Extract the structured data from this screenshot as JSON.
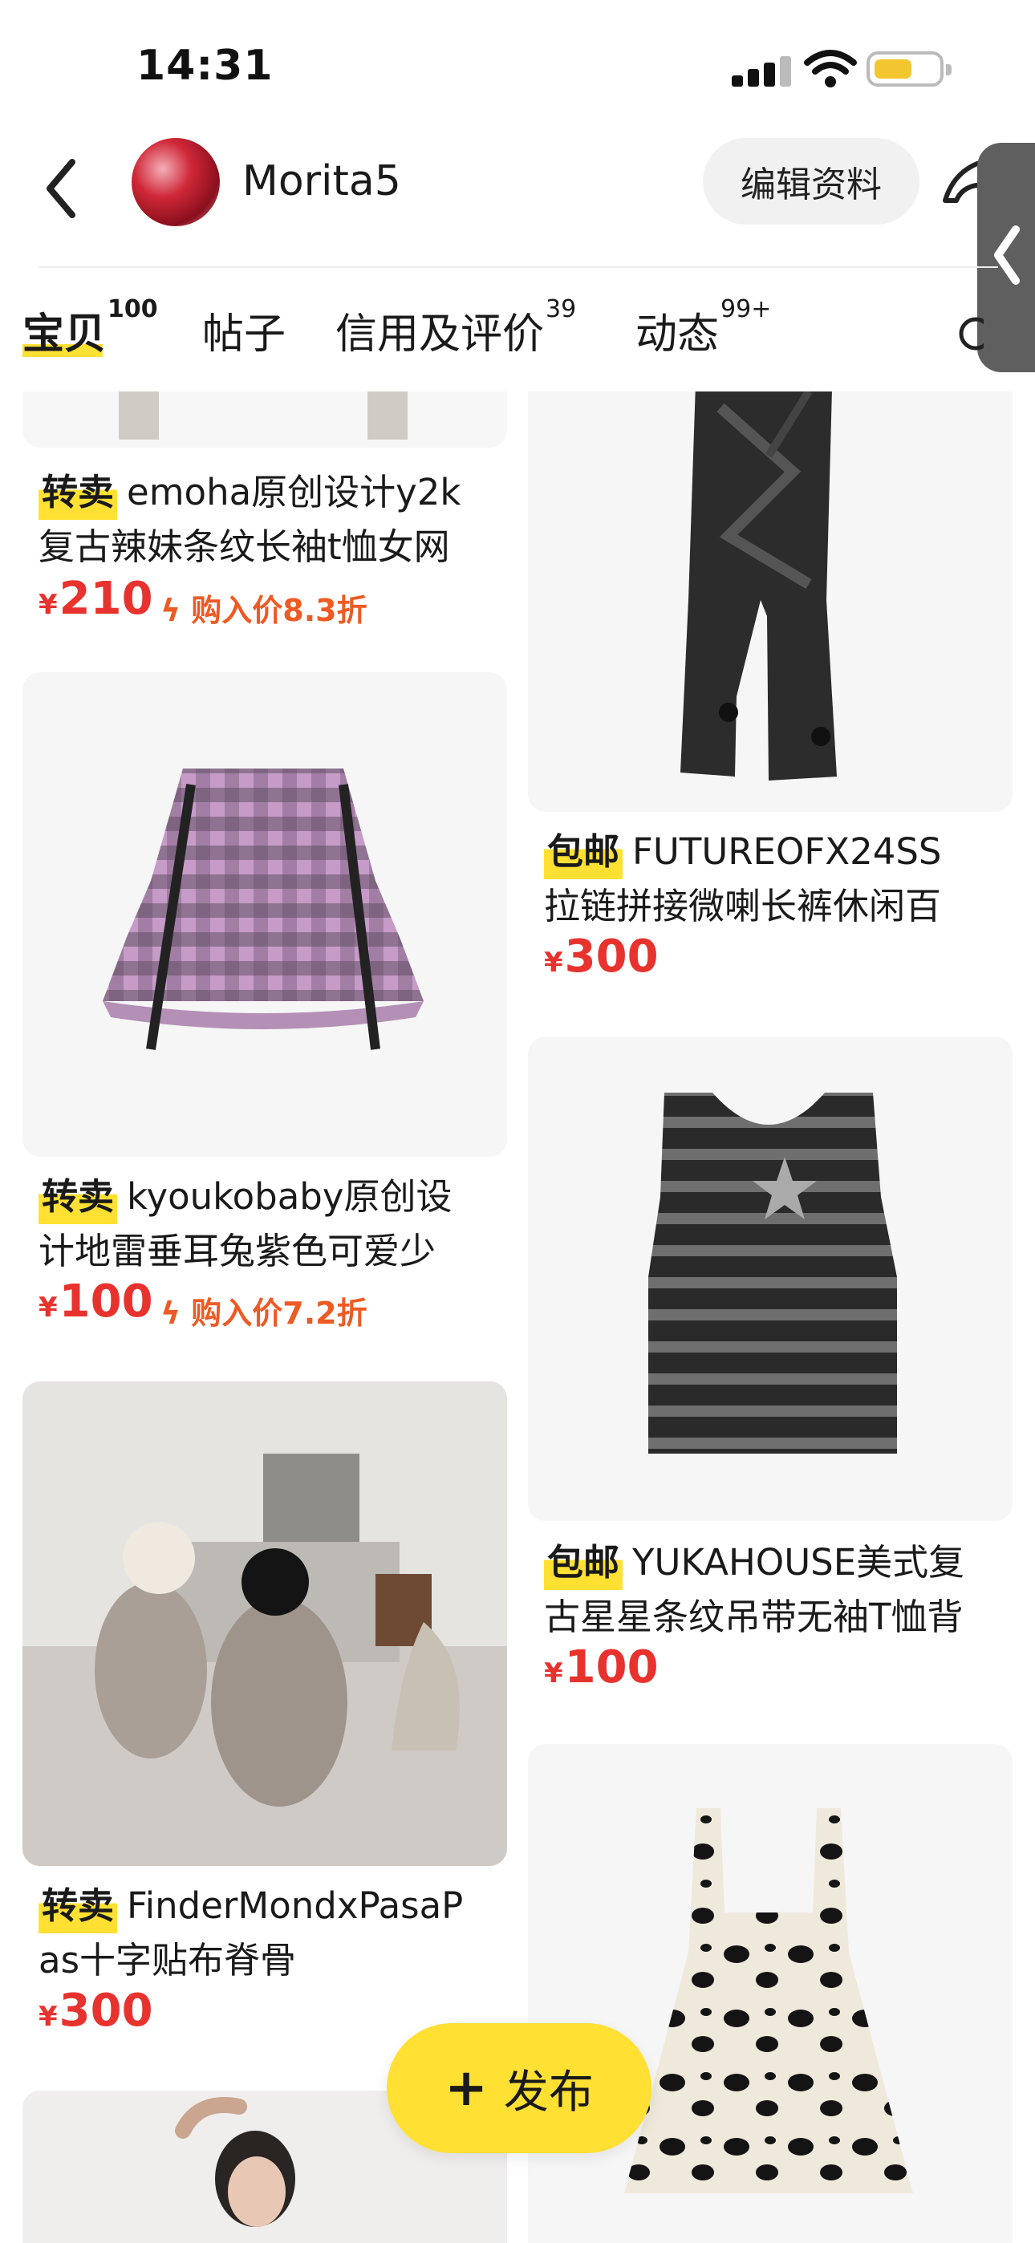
{
  "status_bar": {
    "time": "14:31",
    "battery_level": 0.6
  },
  "profile": {
    "username": "Morita5",
    "edit_label": "编辑资料"
  },
  "tabs": [
    {
      "label": "宝贝",
      "count": "100"
    },
    {
      "label": "帖子",
      "count": ""
    },
    {
      "label": "信用及评价",
      "count": "39"
    },
    {
      "label": "动态",
      "count": "99+"
    }
  ],
  "items": [
    {
      "tag": "转卖",
      "title_line1": "emoha原创设计y2k",
      "title_line2": "复古辣妹条纹长袖t恤女网",
      "currency": "¥",
      "price": "210",
      "discount": "购入价8.3折",
      "image": "partial-clothing-photo"
    },
    {
      "tag": "包邮",
      "title_line1": "FUTUREOFX24SS",
      "title_line2": "拉链拼接微喇长裤休闲百",
      "currency": "¥",
      "price": "300",
      "image": "black-flared-pants-photo"
    },
    {
      "tag": "转卖",
      "title_line1": "kyoukobaby原创设",
      "title_line2": "计地雷垂耳兔紫色可爱少",
      "currency": "¥",
      "price": "100",
      "discount": "购入价7.2折",
      "image": "purple-plaid-skirt-photo"
    },
    {
      "tag": "包邮",
      "title_line1": "YUKAHOUSE美式复",
      "title_line2": "古星星条纹吊带无袖T恤背",
      "currency": "¥",
      "price": "100",
      "image": "striped-tank-top-photo"
    },
    {
      "tag": "转卖",
      "title_line1": "FinderMondxPasaP",
      "title_line2": "as十字贴布脊骨",
      "currency": "¥",
      "price": "300",
      "image": "two-models-bedroom-photo"
    },
    {
      "image": "cow-print-dress-photo"
    },
    {
      "image": "model-portrait-photo"
    }
  ],
  "publish_button": {
    "label": "发布"
  }
}
